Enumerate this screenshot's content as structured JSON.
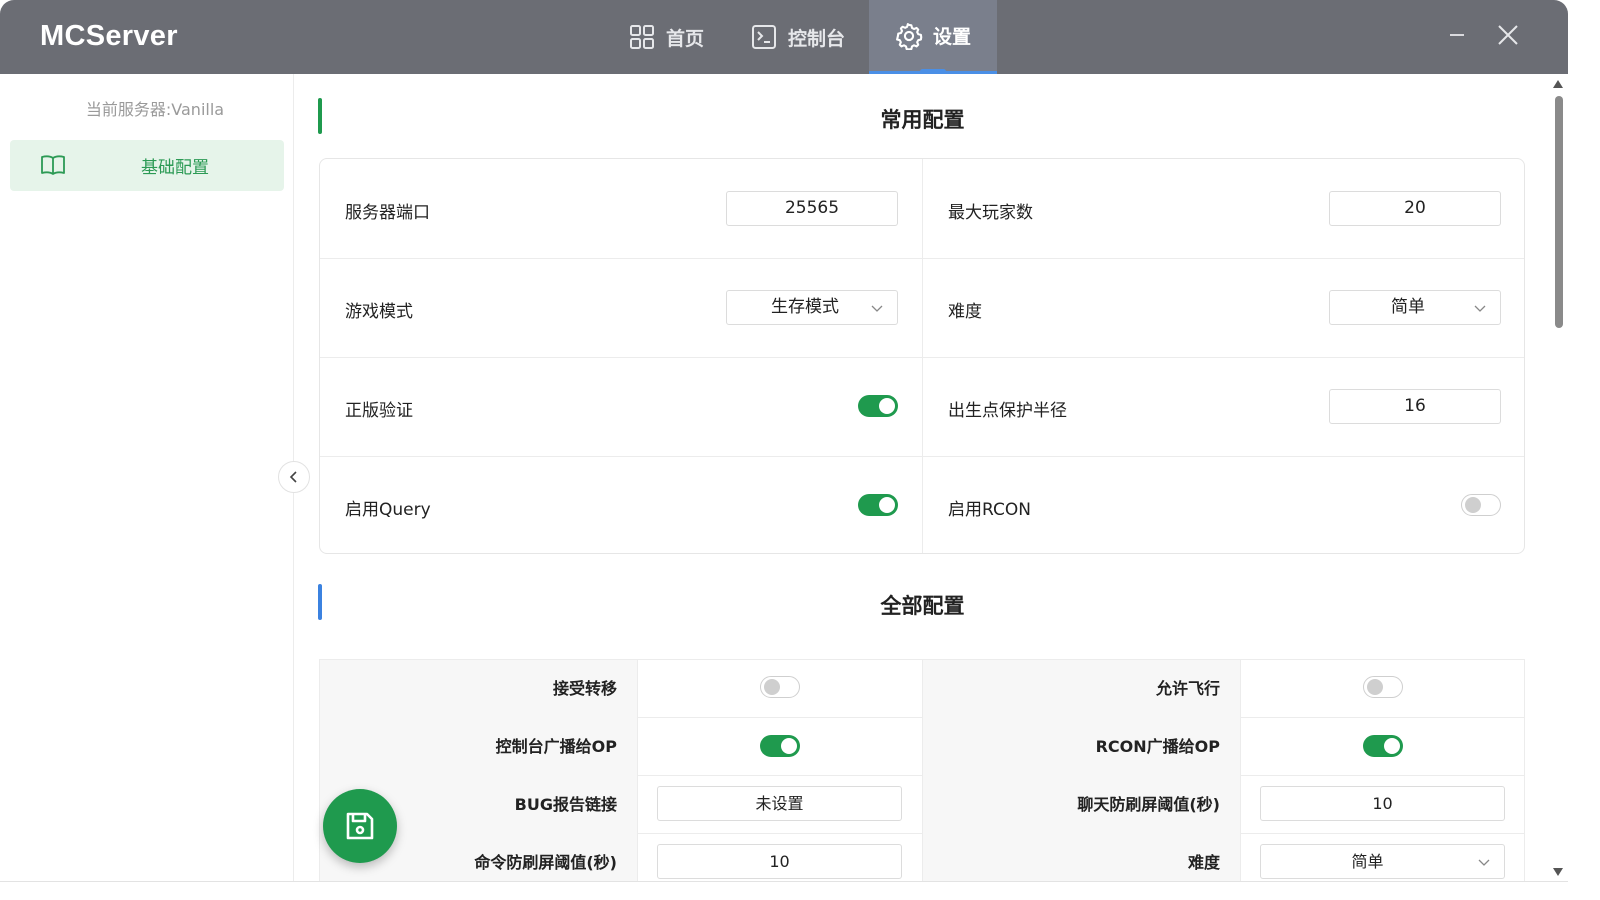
{
  "app": {
    "title": "MCServer"
  },
  "tabs": [
    {
      "label": "首页",
      "icon": "grid-icon"
    },
    {
      "label": "控制台",
      "icon": "terminal-icon"
    },
    {
      "label": "设置",
      "icon": "gear-icon",
      "active": true
    }
  ],
  "sidebar": {
    "current_server": "当前服务器:Vanilla",
    "items": [
      {
        "label": "基础配置",
        "icon": "book-icon",
        "active": true
      }
    ]
  },
  "common": {
    "title": "常用配置",
    "server_port": {
      "label": "服务器端口",
      "value": "25565"
    },
    "max_players": {
      "label": "最大玩家数",
      "value": "20"
    },
    "game_mode": {
      "label": "游戏模式",
      "value": "生存模式"
    },
    "difficulty": {
      "label": "难度",
      "value": "简单"
    },
    "online_mode": {
      "label": "正版验证",
      "on": true
    },
    "spawn_protection": {
      "label": "出生点保护半径",
      "value": "16"
    },
    "enable_query": {
      "label": "启用Query",
      "on": true
    },
    "enable_rcon": {
      "label": "启用RCON",
      "on": false
    }
  },
  "all": {
    "title": "全部配置",
    "rows": [
      {
        "left_label": "接受转移",
        "left_toggle": false,
        "right_label": "允许飞行",
        "right_toggle": false
      },
      {
        "left_label": "控制台广播给OP",
        "left_toggle": true,
        "right_label": "RCON广播给OP",
        "right_toggle": true
      },
      {
        "left_label": "BUG报告链接",
        "left_value": "未设置",
        "right_label": "聊天防刷屏阈值(秒)",
        "right_value": "10"
      },
      {
        "left_label": "命令防刷屏阈值(秒)",
        "left_value": "10",
        "right_label": "难度",
        "right_value": "简单"
      }
    ]
  },
  "colors": {
    "accent_green": "#1f9a4e",
    "titlebar": "#6b6d74",
    "tab_indicator": "#4a8fe6",
    "sidebar_active_bg": "#e6f4ea"
  }
}
